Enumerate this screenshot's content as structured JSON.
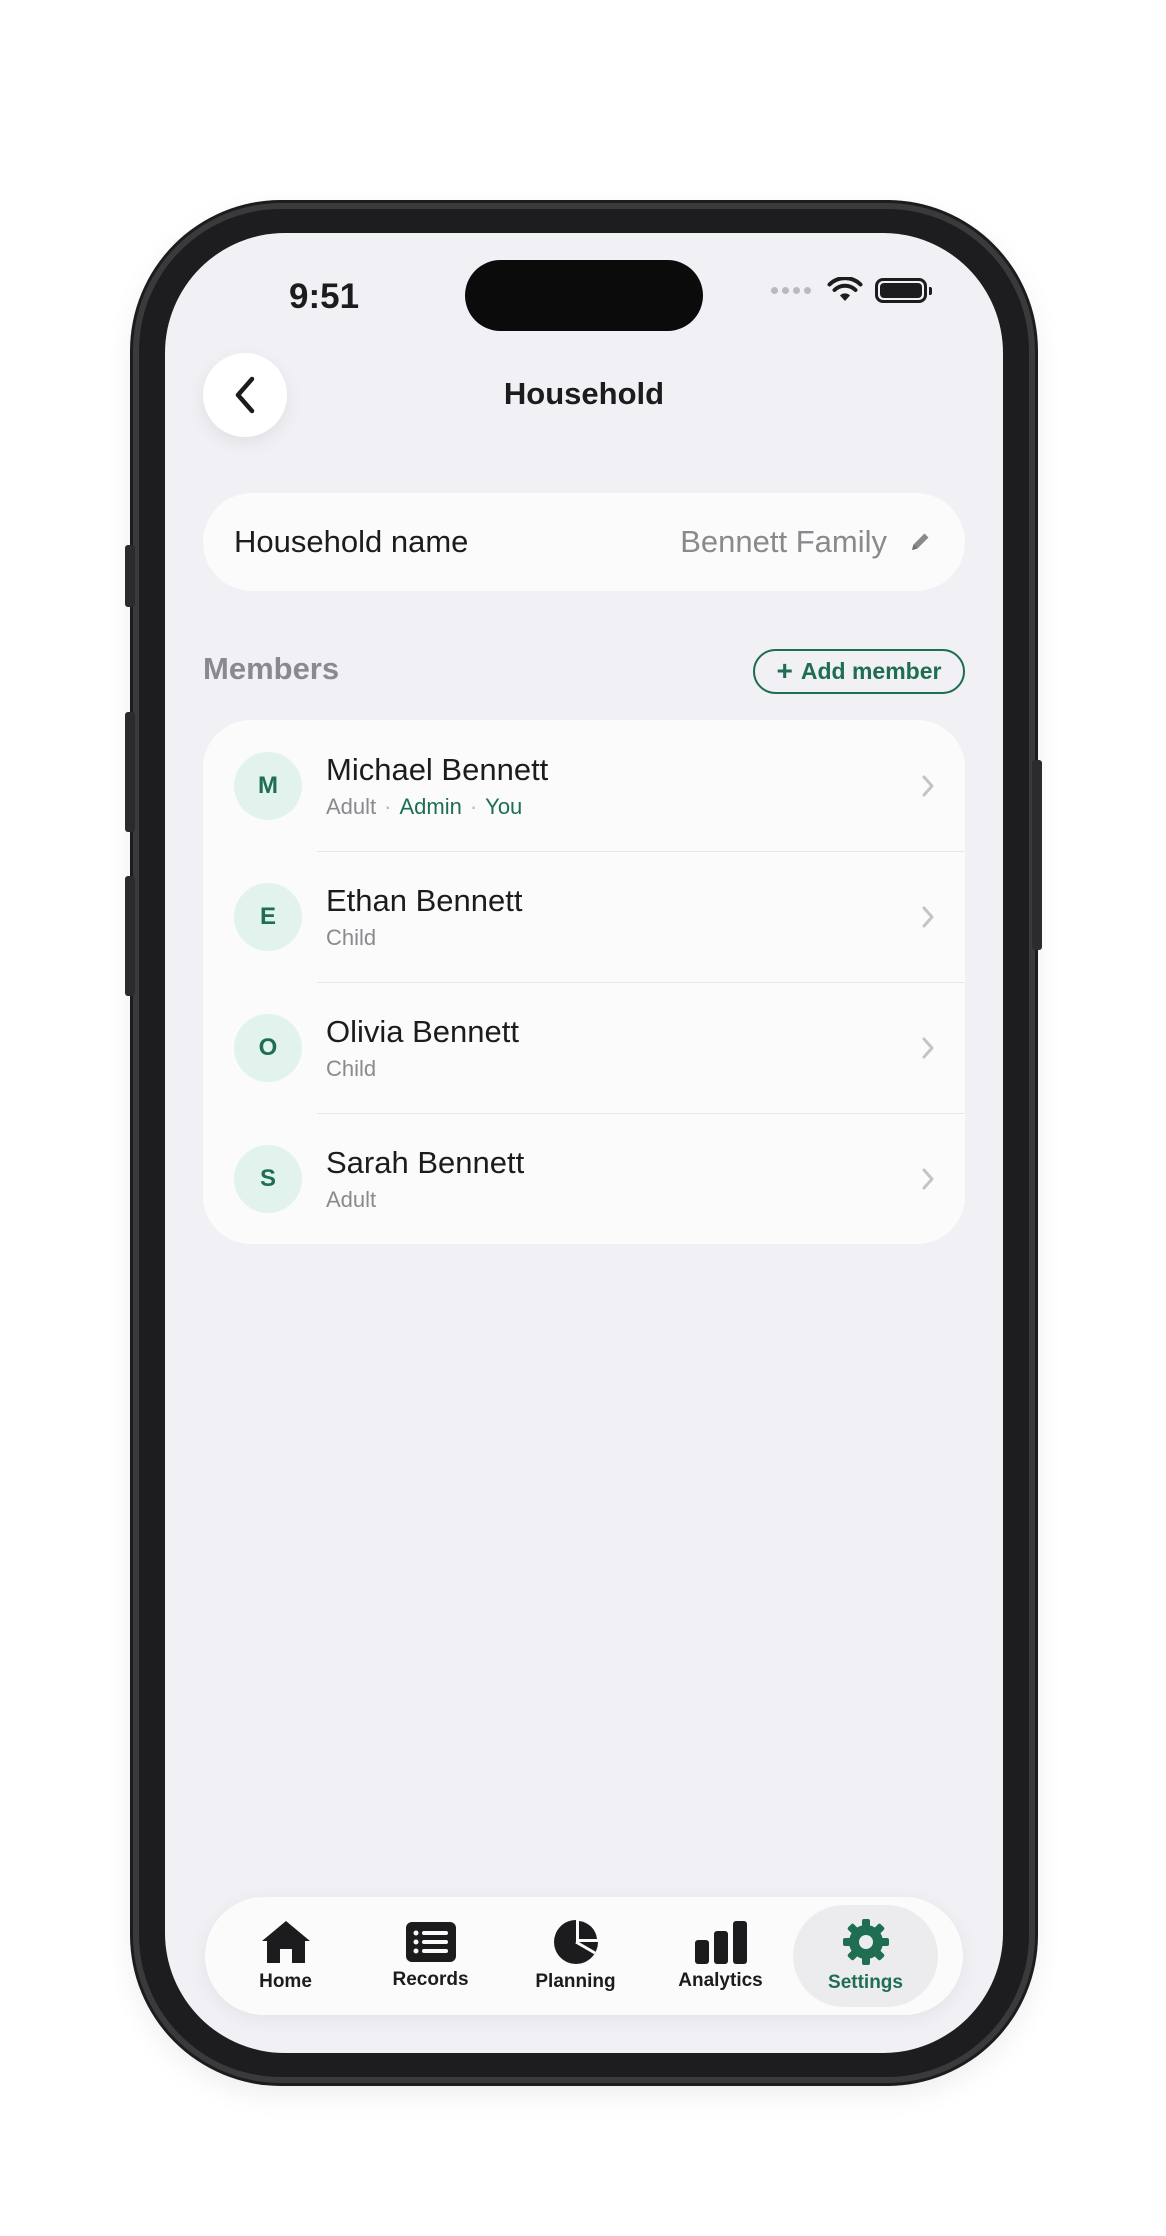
{
  "status_bar": {
    "time": "9:51"
  },
  "header": {
    "title": "Household"
  },
  "household": {
    "label": "Household name",
    "value": "Bennett Family"
  },
  "members_section": {
    "heading": "Members",
    "add_label": "Add member"
  },
  "members": [
    {
      "initial": "M",
      "name": "Michael Bennett",
      "role": "Adult",
      "admin": "Admin",
      "you": "You"
    },
    {
      "initial": "E",
      "name": "Ethan Bennett",
      "role": "Child"
    },
    {
      "initial": "O",
      "name": "Olivia Bennett",
      "role": "Child"
    },
    {
      "initial": "S",
      "name": "Sarah Bennett",
      "role": "Adult"
    }
  ],
  "tabs": [
    {
      "label": "Home",
      "icon": "house-icon"
    },
    {
      "label": "Records",
      "icon": "list-icon"
    },
    {
      "label": "Planning",
      "icon": "pie-chart-icon"
    },
    {
      "label": "Analytics",
      "icon": "bar-chart-icon"
    },
    {
      "label": "Settings",
      "icon": "gear-icon",
      "active": true
    }
  ],
  "colors": {
    "accent": "#1f6e52",
    "background": "#f1f1f5",
    "card": "#fbfbfc",
    "secondary_text": "#8a8a8e"
  }
}
